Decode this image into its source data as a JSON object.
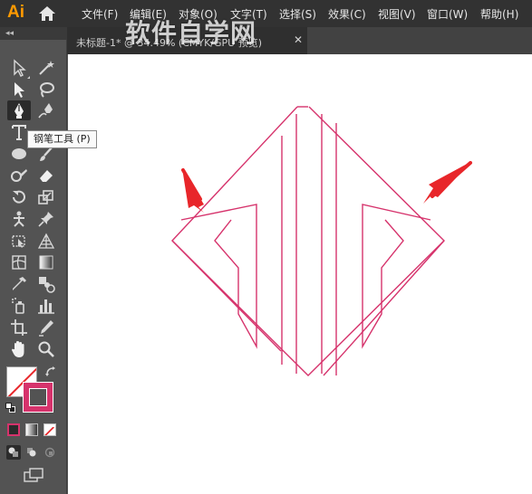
{
  "app": {
    "logo": "Ai"
  },
  "menu": {
    "items": [
      "文件(F)",
      "编辑(E)",
      "对象(O)",
      "文字(T)",
      "选择(S)",
      "效果(C)",
      "视图(V)",
      "窗口(W)",
      "帮助(H)"
    ]
  },
  "toolbar": {
    "collapse": "◂◂"
  },
  "document_tab": {
    "title": "未标题-1* @ 34.49% (CMYK/GPU 预览)",
    "close": "✕"
  },
  "tooltip": {
    "text": "钢笔工具 (P)"
  },
  "watermark": {
    "text": "软件自学网"
  },
  "colors": {
    "menubar_bg": "#323232",
    "tool_panel_bg": "#535353",
    "canvas_bg": "#ffffff",
    "stroke": "#d6336c",
    "arrow": "#e8262a",
    "logo": "#ff9a00"
  },
  "icons": [
    "home-icon",
    "selection-tool-icon",
    "magic-wand-icon",
    "direct-selection-icon",
    "lasso-icon",
    "pen-tool-icon",
    "curvature-tool-icon",
    "type-tool-icon",
    "ellipse-tool-icon",
    "paintbrush-icon",
    "shaper-tool-icon",
    "eraser-icon",
    "rotate-tool-icon",
    "scale-tool-icon",
    "puppet-warp-icon",
    "pin-icon",
    "free-transform-icon",
    "perspective-grid-icon",
    "mesh-tool-icon",
    "gradient-tool-icon",
    "eyedropper-icon",
    "blend-tool-icon",
    "symbol-sprayer-icon",
    "column-graph-icon",
    "artboard-tool-icon",
    "slice-tool-icon",
    "hand-tool-icon",
    "zoom-tool-icon",
    "swap-colors-icon",
    "default-colors-icon",
    "fill-swatch",
    "stroke-swatch",
    "color-mode-icon",
    "gradient-mode-icon",
    "none-mode-icon",
    "draw-normal-icon",
    "draw-behind-icon",
    "draw-inside-icon",
    "screen-mode-icon"
  ]
}
